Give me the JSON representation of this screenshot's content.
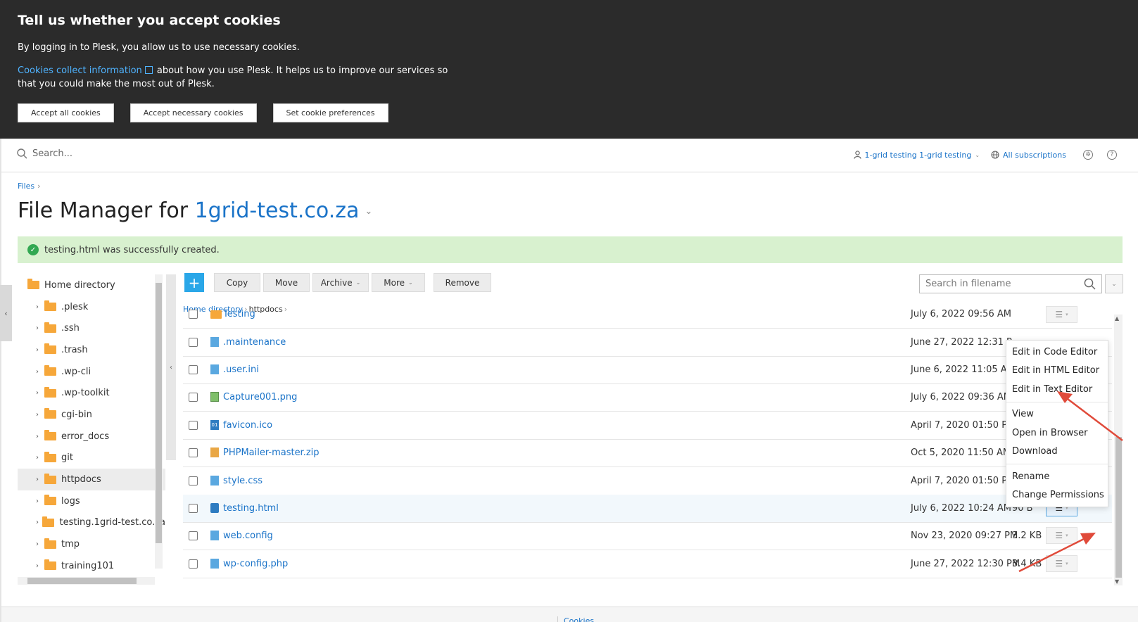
{
  "cookie": {
    "title": "Tell us whether you accept cookies",
    "line1": "By logging in to Plesk, you allow us to use necessary cookies.",
    "link": "Cookies collect information",
    "line2": "about how you use Plesk. It helps us to improve our services so that you could make the most out of Plesk.",
    "accept_all": "Accept all cookies",
    "accept_necessary": "Accept necessary cookies",
    "preferences": "Set cookie preferences"
  },
  "header": {
    "search_placeholder": "Search...",
    "user": "1-grid testing 1-grid testing",
    "subscriptions": "All subscriptions"
  },
  "breadcrumb": {
    "files": "Files"
  },
  "title": {
    "prefix": "File Manager for",
    "domain": "1grid-test.co.za"
  },
  "success_message": "testing.html was successfully created.",
  "tree": {
    "root": "Home directory",
    "items": [
      ".plesk",
      ".ssh",
      ".trash",
      ".wp-cli",
      ".wp-toolkit",
      "cgi-bin",
      "error_docs",
      "git",
      "httpdocs",
      "logs",
      "testing.1grid-test.co.za",
      "tmp",
      "training101"
    ]
  },
  "toolbar": {
    "add": "+",
    "copy": "Copy",
    "move": "Move",
    "archive": "Archive",
    "more": "More",
    "remove": "Remove",
    "search_placeholder": "Search in filename"
  },
  "path": {
    "home": "Home directory",
    "current": "httpdocs"
  },
  "files": [
    {
      "name": "Testing",
      "date": "July 6, 2022 09:56 AM",
      "size": "",
      "icon": "folder"
    },
    {
      "name": ".maintenance",
      "date": "June 27, 2022 12:31 P",
      "size": "",
      "icon": "doc"
    },
    {
      "name": ".user.ini",
      "date": "June 6, 2022 11:05 AM",
      "size": "",
      "icon": "doc"
    },
    {
      "name": "Capture001.png",
      "date": "July 6, 2022 09:36 AM",
      "size": "",
      "icon": "image"
    },
    {
      "name": "favicon.ico",
      "date": "April 7, 2020 01:50 PM",
      "size": "",
      "icon": "ico"
    },
    {
      "name": "PHPMailer-master.zip",
      "date": "Oct 5, 2020 11:50 AM",
      "size": "",
      "icon": "zip"
    },
    {
      "name": "style.css",
      "date": "April 7, 2020 01:50 PM",
      "size": "",
      "icon": "doc"
    },
    {
      "name": "testing.html",
      "date": "July 6, 2022 10:24 AM",
      "size": "90 B",
      "icon": "web"
    },
    {
      "name": "web.config",
      "date": "Nov 23, 2020 09:27 PM",
      "size": "3.2 KB",
      "icon": "doc"
    },
    {
      "name": "wp-config.php",
      "date": "June 27, 2022 12:30 PM",
      "size": "3.4 KB",
      "icon": "doc"
    }
  ],
  "context_menu": {
    "edit_code": "Edit in Code Editor",
    "edit_html": "Edit in HTML Editor",
    "edit_text": "Edit in Text Editor",
    "view": "View",
    "open_browser": "Open in Browser",
    "download": "Download",
    "rename": "Rename",
    "permissions": "Change Permissions"
  },
  "footer": {
    "cookies": "Cookies"
  },
  "colors": {
    "accent": "#1a73c8",
    "banner": "#2b2b2b",
    "success_bg": "#d8f1cf",
    "annotation_arrow": "#e04a3a"
  }
}
